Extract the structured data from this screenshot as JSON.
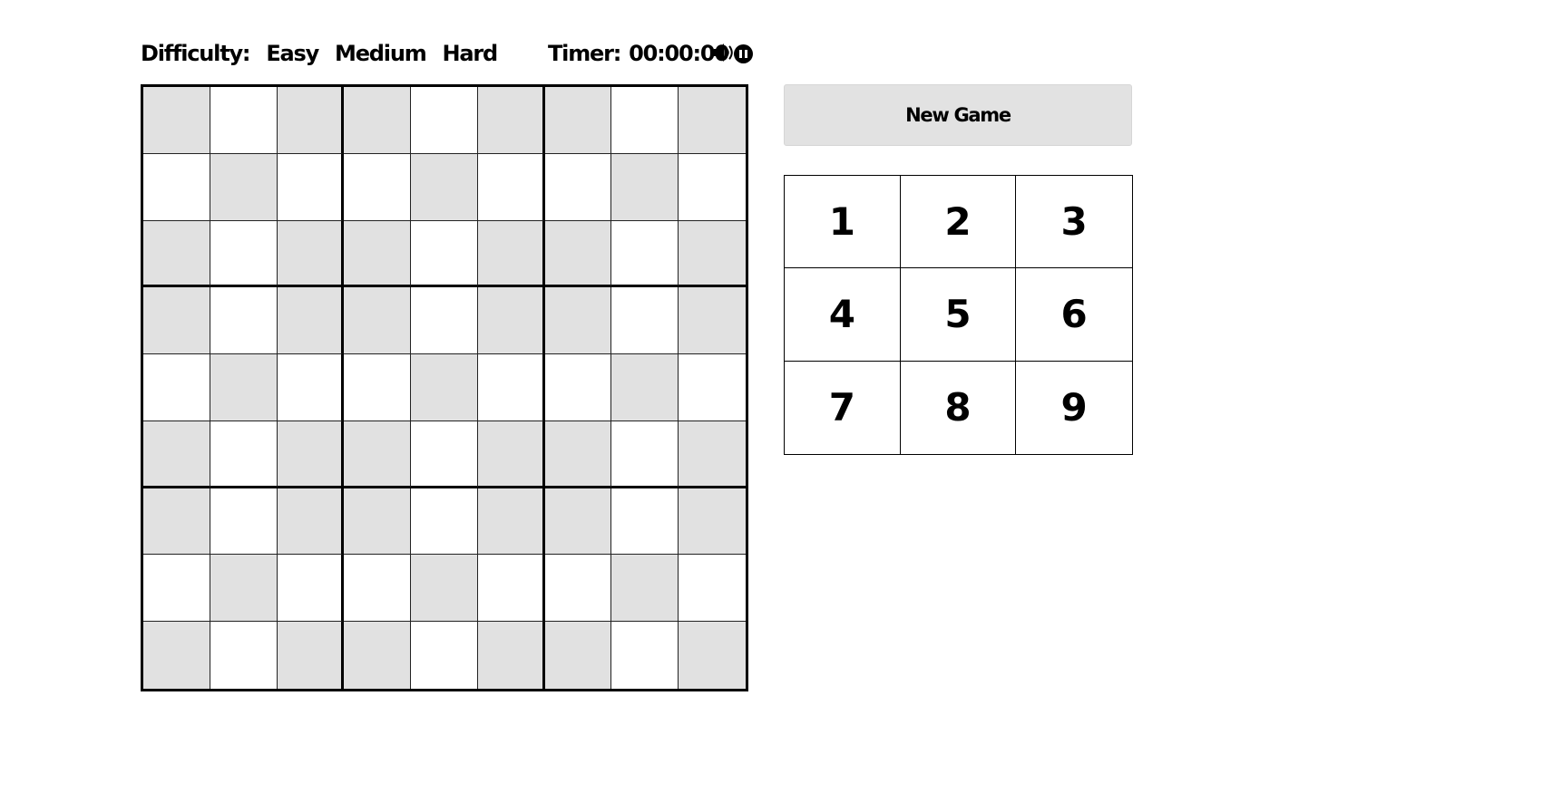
{
  "header": {
    "difficulty_label": "Difficulty:",
    "difficulty_options": [
      "Easy",
      "Medium",
      "Hard"
    ],
    "timer_label": "Timer:",
    "timer_value": "00:00:00",
    "pause_icon": "pause-circle-icon",
    "sound_icon": "speaker-volume-icon"
  },
  "board": {
    "size": 9,
    "cells": [
      [
        "",
        "",
        "",
        "",
        "",
        "",
        "",
        "",
        ""
      ],
      [
        "",
        "",
        "",
        "",
        "",
        "",
        "",
        "",
        ""
      ],
      [
        "",
        "",
        "",
        "",
        "",
        "",
        "",
        "",
        ""
      ],
      [
        "",
        "",
        "",
        "",
        "",
        "",
        "",
        "",
        ""
      ],
      [
        "",
        "",
        "",
        "",
        "",
        "",
        "",
        "",
        ""
      ],
      [
        "",
        "",
        "",
        "",
        "",
        "",
        "",
        "",
        ""
      ],
      [
        "",
        "",
        "",
        "",
        "",
        "",
        "",
        "",
        ""
      ],
      [
        "",
        "",
        "",
        "",
        "",
        "",
        "",
        "",
        ""
      ],
      [
        "",
        "",
        "",
        "",
        "",
        "",
        "",
        "",
        ""
      ]
    ],
    "shade_pattern": [
      [
        1,
        0,
        1
      ],
      [
        0,
        1,
        0
      ],
      [
        1,
        0,
        1
      ]
    ],
    "colors": {
      "shaded": "#e1e1e1",
      "plain": "#ffffff"
    }
  },
  "controls": {
    "new_game_label": "New Game",
    "numpad": [
      "1",
      "2",
      "3",
      "4",
      "5",
      "6",
      "7",
      "8",
      "9"
    ]
  }
}
